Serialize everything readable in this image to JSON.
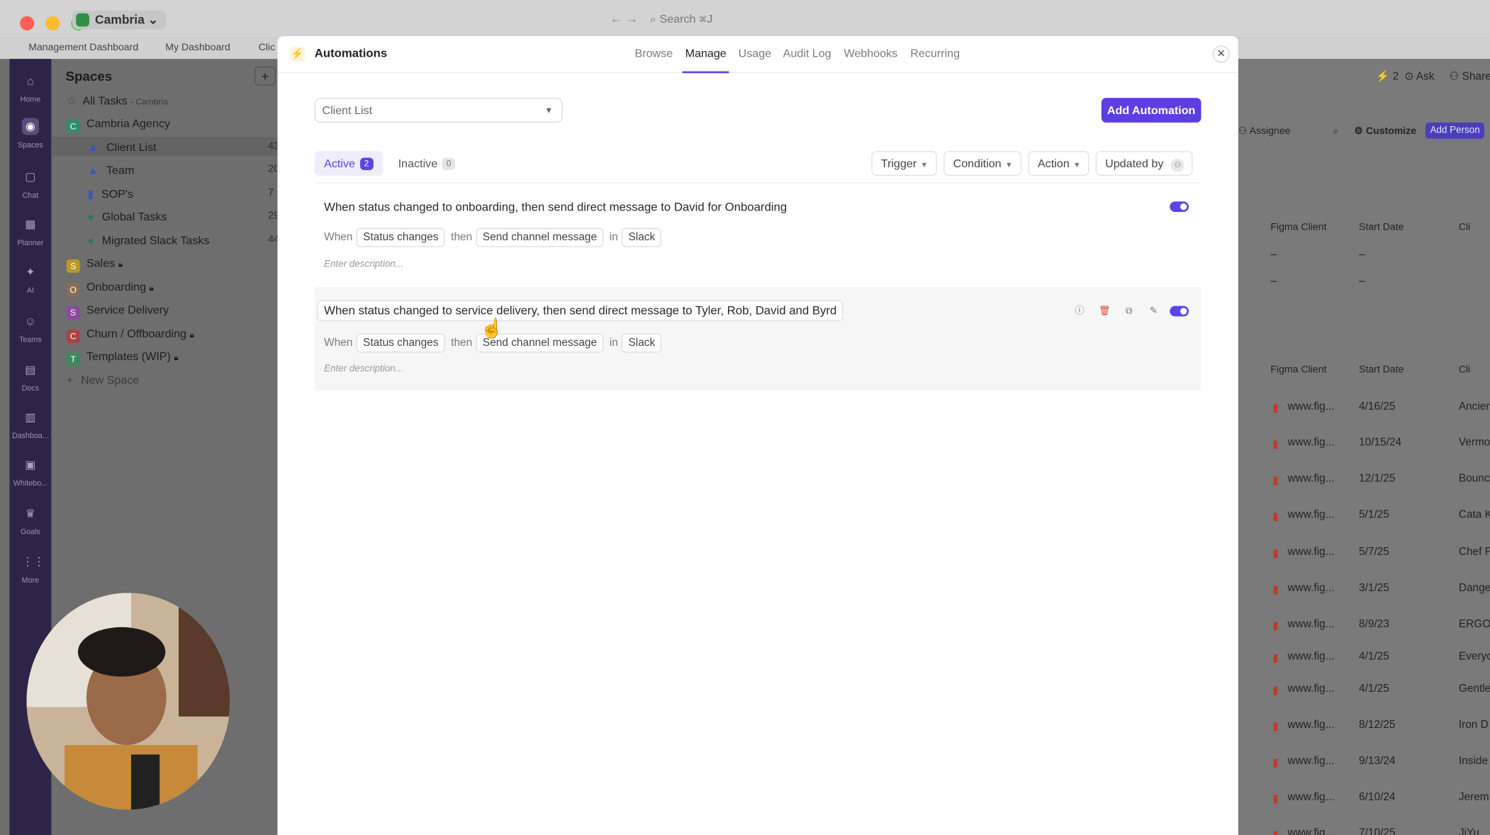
{
  "browser": {
    "workspace": "Cambria",
    "search_placeholder": "Search",
    "search_shortcut": "⌘J",
    "bookmarks": [
      "Management Dashboard",
      "My Dashboard",
      "Clic"
    ]
  },
  "rail": {
    "items": [
      "Home",
      "Spaces",
      "Chat",
      "Planner",
      "AI",
      "Teams",
      "Docs",
      "Dashboa...",
      "Whitebo...",
      "Goals",
      "More"
    ]
  },
  "sidebar": {
    "title": "Spaces",
    "all_tasks": "All Tasks",
    "all_tasks_suffix": "- Cambria",
    "agency": "Cambria Agency",
    "lists": [
      {
        "label": "Client List",
        "count": "43"
      },
      {
        "label": "Team",
        "count": "20"
      },
      {
        "label": "SOP's",
        "count": "7"
      },
      {
        "label": "Global Tasks",
        "count": "29"
      },
      {
        "label": "Migrated Slack Tasks",
        "count": "44"
      }
    ],
    "spaces": [
      {
        "letter": "S",
        "label": "Sales"
      },
      {
        "letter": "O",
        "label": "Onboarding"
      },
      {
        "letter": "S",
        "label": "Service Delivery"
      },
      {
        "letter": "C",
        "label": "Churn / Offboarding"
      },
      {
        "letter": "T",
        "label": "Templates (WIP)"
      }
    ],
    "new_space": "New Space"
  },
  "background_right": {
    "count": "2",
    "ask": "Ask",
    "share": "Share",
    "assignee": "Assignee",
    "customize": "Customize",
    "add_person": "Add Person",
    "col_figma": "Figma Client",
    "col_start": "Start Date",
    "col_cli": "Cli",
    "dash": "–",
    "rows": [
      {
        "figma": "www.fig...",
        "date": "4/16/25",
        "client": "Ancier"
      },
      {
        "figma": "www.fig...",
        "date": "10/15/24",
        "client": "Vermo"
      },
      {
        "figma": "www.fig...",
        "date": "12/1/25",
        "client": "Bounc"
      },
      {
        "figma": "www.fig...",
        "date": "5/1/25",
        "client": "Cata K"
      },
      {
        "figma": "www.fig...",
        "date": "5/7/25",
        "client": "Chef F"
      },
      {
        "figma": "www.fig...",
        "date": "3/1/25",
        "client": "Dange"
      },
      {
        "figma": "www.fig...",
        "date": "8/9/23",
        "client": "ERGO"
      },
      {
        "figma": "www.fig...",
        "date": "4/1/25",
        "client": "Everyo"
      },
      {
        "figma": "www.fig...",
        "date": "4/1/25",
        "client": "Gentle"
      },
      {
        "figma": "www.fig...",
        "date": "8/12/25",
        "client": "Iron D"
      },
      {
        "figma": "www.fig...",
        "date": "9/13/24",
        "client": "Inside"
      },
      {
        "figma": "www.fig...",
        "date": "6/10/24",
        "client": "Jerem"
      },
      {
        "figma": "www.fig...",
        "date": "7/10/25",
        "client": "JiYu"
      }
    ]
  },
  "modal": {
    "title": "Automations",
    "tabs": [
      "Browse",
      "Manage",
      "Usage",
      "Audit Log",
      "Webhooks",
      "Recurring"
    ],
    "active_tab": "Manage",
    "list_select": "Client List",
    "add_button": "Add Automation",
    "status_tabs": {
      "active": "Active",
      "active_count": "2",
      "inactive": "Inactive",
      "inactive_count": "0"
    },
    "filters": {
      "trigger": "Trigger",
      "condition": "Condition",
      "action": "Action",
      "updated_by": "Updated by"
    },
    "words": {
      "when": "When",
      "then": "then",
      "in": "in"
    },
    "automations": [
      {
        "title": "When status changed to onboarding, then send direct message to David for Onboarding",
        "trigger": "Status changes",
        "action": "Send channel message",
        "channel": "Slack",
        "description_placeholder": "Enter description...",
        "enabled": true
      },
      {
        "title": "When status changed to service delivery, then send direct message to Tyler, Rob, David and Byrd",
        "trigger": "Status changes",
        "action": "Send channel message",
        "channel": "Slack",
        "description_placeholder": "Enter description...",
        "enabled": true
      }
    ]
  },
  "colors": {
    "accent": "#5a45e6",
    "button": "#5b3fe0"
  }
}
